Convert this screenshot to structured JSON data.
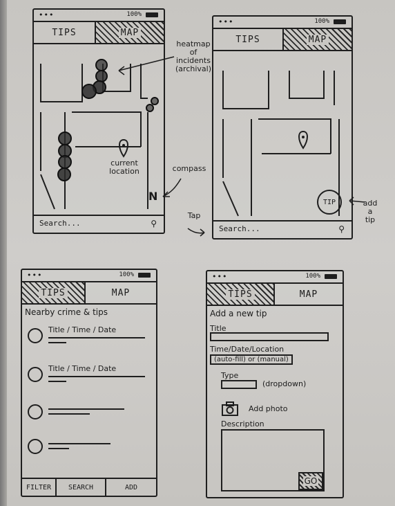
{
  "status": {
    "dots": "•••",
    "battery": "100%"
  },
  "tabs": {
    "tips": "TIPS",
    "map": "MAP"
  },
  "search": {
    "label": "Search...",
    "icon": "search-icon"
  },
  "annotations": {
    "heatmap": [
      "heatmap",
      "of",
      "incidents",
      "(archival)"
    ],
    "compass": "compass",
    "tap": "Tap",
    "add_tip": [
      "add",
      "a",
      "tip"
    ]
  },
  "map": {
    "current_location": [
      "current",
      "location"
    ],
    "compass_letter": "N",
    "tip_button": "TIP"
  },
  "list": {
    "heading": "Nearby crime & tips",
    "rows": [
      {
        "title": "Title / Time / Date"
      },
      {
        "title": "Title / Time / Date"
      },
      {
        "title": ""
      },
      {
        "title": ""
      }
    ]
  },
  "bottom_bar": {
    "filter": "FILTER",
    "search": "SEARCH",
    "add": "ADD"
  },
  "form": {
    "heading": "Add a new tip",
    "title_label": "Title",
    "time_label": "Time/Date/Location",
    "time_hint": "(auto-fill) or (manual)",
    "type_label": "Type",
    "type_hint": "(dropdown)",
    "photo_label": "Add photo",
    "description_label": "Description",
    "go": "GO"
  },
  "colors": {
    "ink": "#1e1e1e",
    "paper": "#cbc9c5"
  }
}
